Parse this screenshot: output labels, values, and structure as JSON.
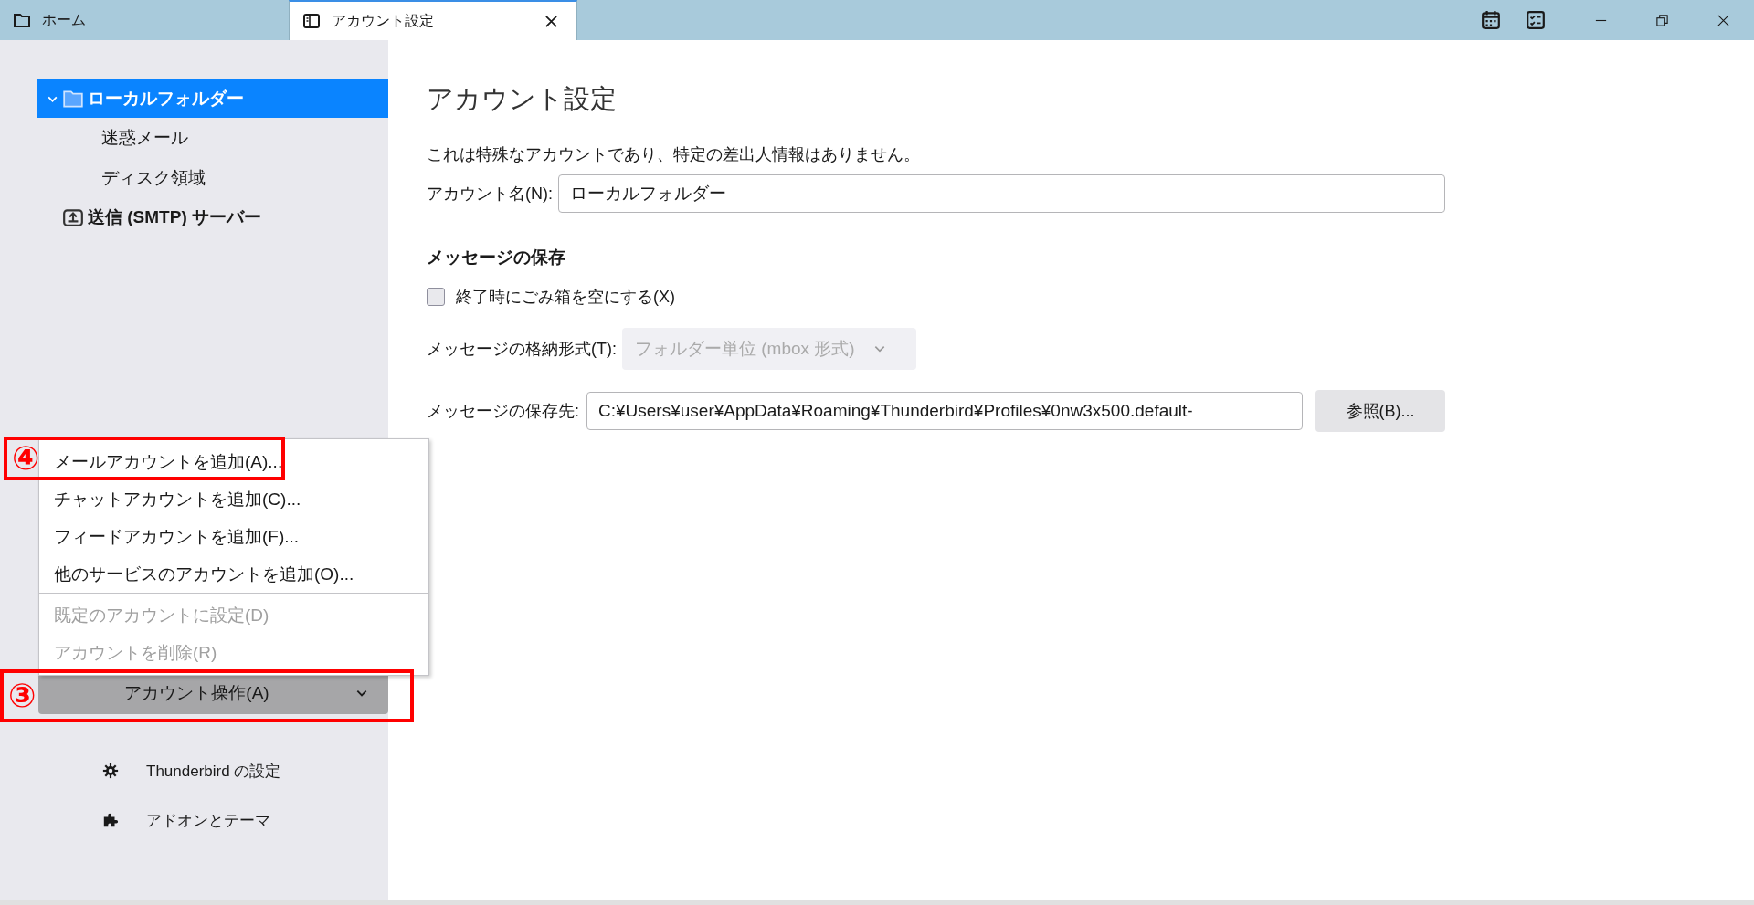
{
  "tabs": [
    {
      "label": "ホーム",
      "kind": "home",
      "selected": false
    },
    {
      "label": "アカウント設定",
      "kind": "settings",
      "selected": true
    }
  ],
  "tree": [
    {
      "label": "ローカルフォルダー",
      "kind": "folder",
      "selected": true,
      "expanded": true,
      "children": [
        {
          "label": "迷惑メール",
          "selected": false
        },
        {
          "label": "ディスク領域",
          "selected": false
        }
      ]
    },
    {
      "label": "送信 (SMTP) サーバー",
      "kind": "outbox",
      "selected": false
    }
  ],
  "account_menu": [
    {
      "label": "メールアカウントを追加(A)...",
      "disabled": false,
      "divider_after": false
    },
    {
      "label": "チャットアカウントを追加(C)...",
      "disabled": false,
      "divider_after": false
    },
    {
      "label": "フィードアカウントを追加(F)...",
      "disabled": false,
      "divider_after": false
    },
    {
      "label": "他のサービスのアカウントを追加(O)...",
      "disabled": false,
      "divider_after": true
    },
    {
      "label": "既定のアカウントに設定(D)",
      "disabled": true,
      "divider_after": false
    },
    {
      "label": "アカウントを削除(R)",
      "disabled": true,
      "divider_after": false
    }
  ],
  "account_actions_button": {
    "label": "アカウント操作(A)"
  },
  "sidebar_footer": [
    {
      "label": "Thunderbird の設定",
      "kind": "settings"
    },
    {
      "label": "アドオンとテーマ",
      "kind": "addons"
    }
  ],
  "main": {
    "title": "アカウント設定",
    "note": "これは特殊なアカウントであり、特定の差出人情報はありません。",
    "account_name": {
      "label": "アカウント名(N):",
      "value": "ローカルフォルダー"
    },
    "section_title": "メッセージの保存",
    "empty_trash": {
      "label": "終了時にごみ箱を空にする(X)",
      "checked": false
    },
    "store_type": {
      "label": "メッセージの格納形式(T):",
      "value": "フォルダー単位 (mbox 形式)",
      "disabled": true
    },
    "local_dir": {
      "label": "メッセージの保存先:",
      "value": "C:¥Users¥user¥AppData¥Roaming¥Thunderbird¥Profiles¥0nw3x500.default-",
      "button": "参照(B)..."
    }
  },
  "menu_annotation": {
    "number": "④"
  },
  "button_annotation": {
    "number": "③"
  }
}
